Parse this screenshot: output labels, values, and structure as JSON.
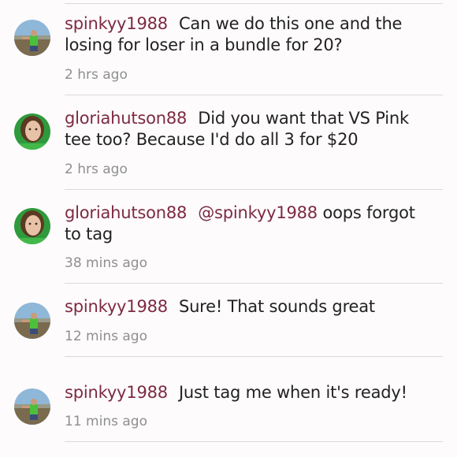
{
  "comments": [
    {
      "username": "spinkyy1988",
      "text": "Can we do this one and the losing for loser  in a bundle for 20?",
      "time": "2 hrs ago",
      "avatar": "outdoor-user-avatar"
    },
    {
      "username": "gloriahutson88",
      "text": "Did you want that VS Pink tee too? Because I'd do all 3 for $20",
      "time": "2 hrs ago",
      "avatar": "portrait-user-avatar"
    },
    {
      "username": "gloriahutson88",
      "mention": "@spinkyy1988",
      "text": " oops forgot to tag",
      "time": "38 mins ago",
      "avatar": "portrait-user-avatar"
    },
    {
      "username": "spinkyy1988",
      "text": "Sure! That sounds great",
      "time": "12 mins ago",
      "avatar": "outdoor-user-avatar"
    },
    {
      "username": "spinkyy1988",
      "text": "Just tag me when it's ready!",
      "time": "11 mins ago",
      "avatar": "outdoor-user-avatar"
    }
  ],
  "colors": {
    "username": "#7d2a42",
    "body_text": "#222222",
    "timestamp": "#8f8f8f",
    "divider": "#dcd9da",
    "background": "#fdfbfc"
  }
}
